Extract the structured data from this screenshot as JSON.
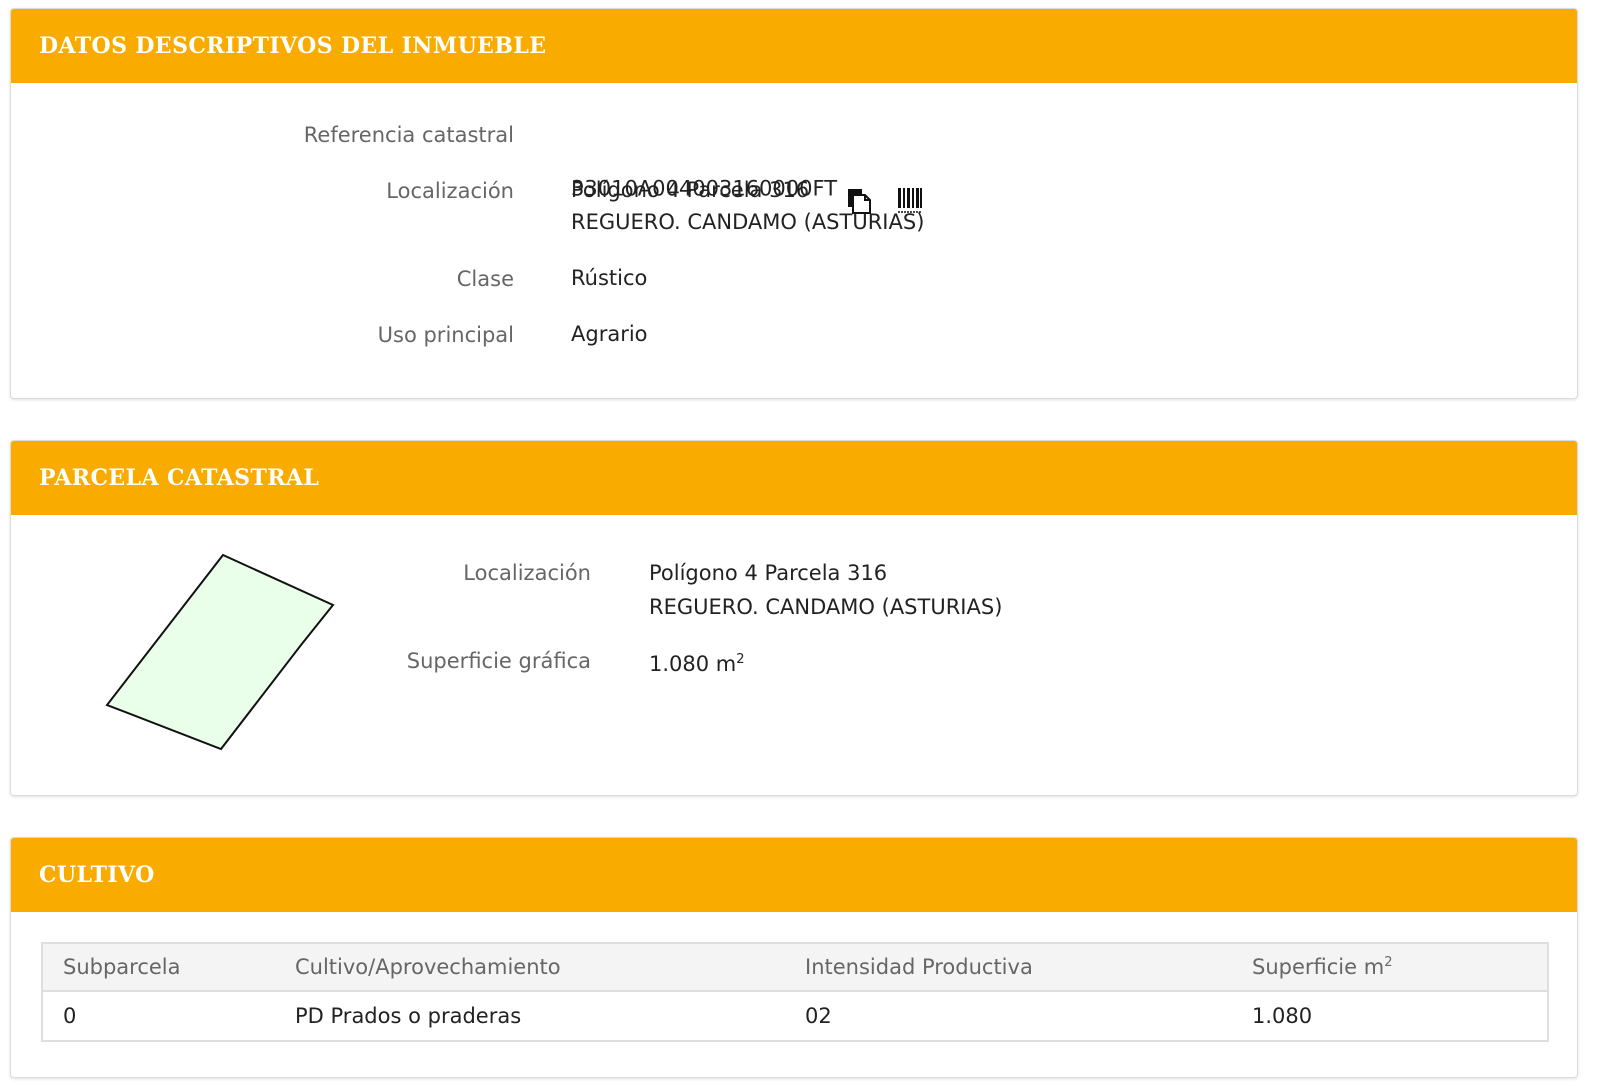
{
  "datos": {
    "title": "DATOS DESCRIPTIVOS DEL INMUEBLE",
    "referencia_label": "Referencia catastral",
    "referencia_value": "33010A004003160000FT",
    "localizacion_label": "Localización",
    "localizacion_value": "Polígono 4 Parcela 316\nREGUERO. CANDAMO (ASTURIAS)",
    "clase_label": "Clase",
    "clase_value": "Rústico",
    "uso_label": "Uso principal",
    "uso_value": "Agrario"
  },
  "parcela": {
    "title": "PARCELA CATASTRAL",
    "localizacion_label": "Localización",
    "localizacion_value": "Polígono 4 Parcela 316\nREGUERO. CANDAMO (ASTURIAS)",
    "superficie_label": "Superficie gráfica",
    "superficie_value": "1.080 m",
    "superficie_unit_sup": "2",
    "shape_fill": "#eaffea"
  },
  "cultivo": {
    "title": "CULTIVO",
    "headers": {
      "subparcela": "Subparcela",
      "cultivo": "Cultivo/Aprovechamiento",
      "intensidad": "Intensidad Productiva",
      "superficie": "Superficie m",
      "superficie_sup": "2"
    },
    "rows": [
      {
        "subparcela": "0",
        "cultivo": "PD Prados o praderas",
        "intensidad": "02",
        "superficie": "1.080"
      }
    ]
  },
  "colors": {
    "header_bg": "#f9ab00",
    "header_text": "#ffffff"
  },
  "icons": [
    "copy-icon",
    "barcode-icon"
  ]
}
